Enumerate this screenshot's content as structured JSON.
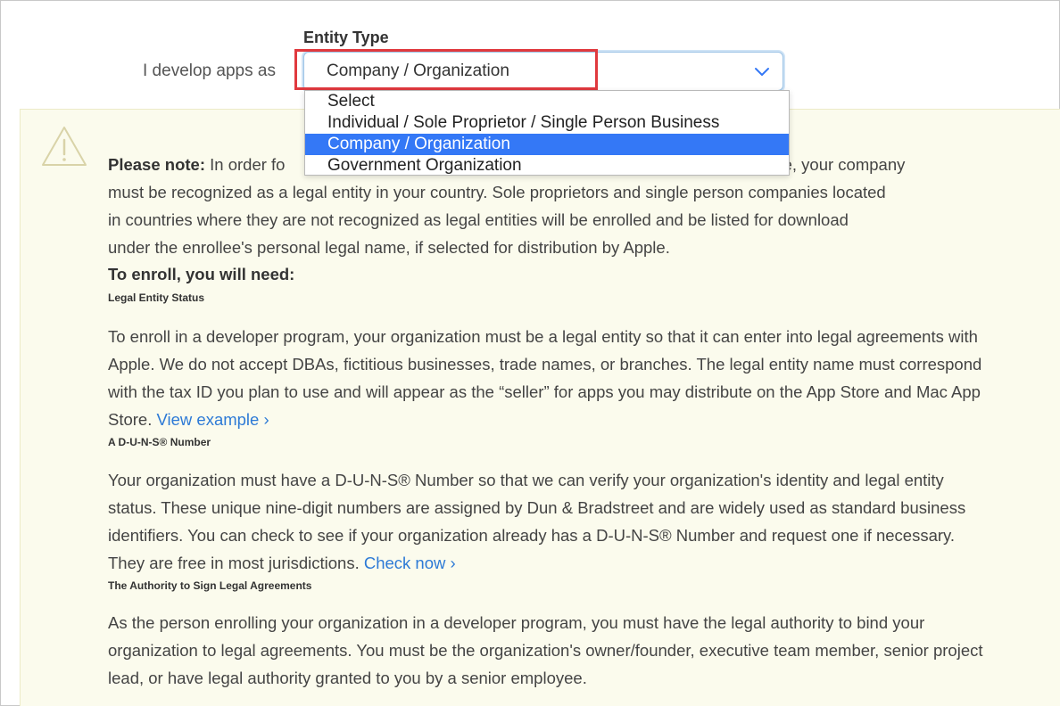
{
  "form": {
    "section_title": "Entity Type",
    "row_label": "I develop apps as",
    "selected_value": "Company / Organization"
  },
  "dropdown": {
    "options": [
      "Select",
      "Individual / Sole Proprietor / Single Person Business",
      "Company / Organization",
      "Government Organization"
    ],
    "selected_index": 2
  },
  "note": {
    "lead_bold": "Please note:",
    "lead_visible": "In order fo",
    "lead_tail": "tore, your company",
    "lines": [
      "must be recognized as a legal entity in your country. Sole proprietors and single person companies located",
      "in countries where they are not recognized as legal entities will be enrolled and be listed for download",
      "under the enrollee's personal legal name, if selected for distribution by Apple."
    ],
    "enroll_heading": "To enroll, you will need:"
  },
  "sections": [
    {
      "title": "Legal Entity Status",
      "body": "To enroll in a developer program, your organization must be a legal entity so that it can enter into legal agreements with Apple. We do not accept DBAs, fictitious businesses, trade names, or branches. The legal entity name must correspond with the tax ID you plan to use and will appear as the “seller” for apps you may distribute on the App Store and Mac App Store.",
      "link": "View example ›"
    },
    {
      "title": "A D-U-N-S® Number",
      "body": "Your organization must have a D-U-N-S® Number so that we can verify your organization's identity and legal entity status. These unique nine-digit numbers are assigned by Dun & Bradstreet and are widely used as standard business identifiers. You can check to see if your organization already has a D-U-N-S® Number and request one if necessary. They are free in most jurisdictions.",
      "link": "Check now ›"
    },
    {
      "title": "The Authority to Sign Legal Agreements",
      "body": "As the person enrolling your organization in a developer program, you must have the legal authority to bind your organization to legal agreements. You must be the organization's owner/founder, executive team member, senior project lead, or have legal authority granted to you by a senior employee."
    }
  ],
  "colors": {
    "highlight": "#e0393e",
    "selected_option": "#3478f6",
    "link": "#2d7ad6",
    "panel_bg": "#fbfbed"
  }
}
